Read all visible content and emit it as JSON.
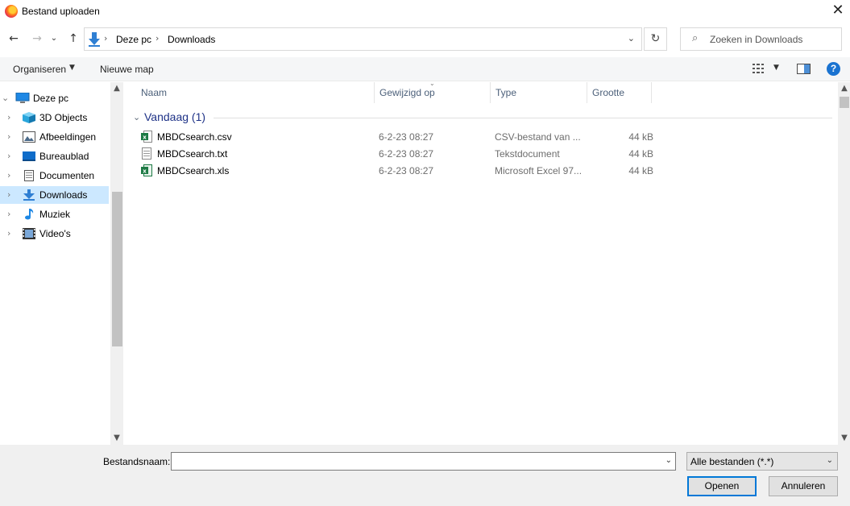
{
  "window": {
    "title": "Bestand uploaden",
    "close_glyph": "✕"
  },
  "nav_buttons": {
    "back_glyph": "←",
    "forward_glyph": "→",
    "recent_glyph": "⌄",
    "up_glyph": "↑"
  },
  "address": {
    "breadcrumbs": [
      "Deze pc",
      "Downloads"
    ],
    "separator": "›",
    "dropdown_glyph": "⌄",
    "refresh_glyph": "↻"
  },
  "search": {
    "placeholder": "Zoeken in Downloads",
    "icon": "search-icon"
  },
  "toolbar": {
    "organize_label": "Organiseren",
    "new_folder_label": "Nieuwe map",
    "help_glyph": "?"
  },
  "nav_pane": {
    "items": [
      {
        "label": "Deze pc",
        "icon": "computer-icon",
        "selected": false
      },
      {
        "label": "3D Objects",
        "icon": "cube-icon",
        "selected": false
      },
      {
        "label": "Afbeeldingen",
        "icon": "pictures-icon",
        "selected": false
      },
      {
        "label": "Bureaublad",
        "icon": "desktop-icon",
        "selected": false
      },
      {
        "label": "Documenten",
        "icon": "documents-icon",
        "selected": false
      },
      {
        "label": "Downloads",
        "icon": "download-icon",
        "selected": true
      },
      {
        "label": "Muziek",
        "icon": "music-icon",
        "selected": false
      },
      {
        "label": "Video's",
        "icon": "video-icon",
        "selected": false
      }
    ]
  },
  "file_list": {
    "columns": [
      "Naam",
      "Gewijzigd op",
      "Type",
      "Grootte"
    ],
    "group": {
      "label": "Vandaag (1)"
    },
    "rows": [
      {
        "name": "MBDCsearch.csv",
        "date": "6-2-23 08:27",
        "type": "CSV-bestand van ...",
        "size": "44 kB",
        "icon": "excel-csv-icon"
      },
      {
        "name": "MBDCsearch.txt",
        "date": "6-2-23 08:27",
        "type": "Tekstdocument",
        "size": "44 kB",
        "icon": "text-file-icon"
      },
      {
        "name": "MBDCsearch.xls",
        "date": "6-2-23 08:27",
        "type": "Microsoft Excel 97...",
        "size": "44 kB",
        "icon": "excel-file-icon"
      }
    ]
  },
  "footer": {
    "filename_label": "Bestandsnaam:",
    "filename_value": "",
    "filter_value": "Alle bestanden (*.*)",
    "open_label": "Openen",
    "cancel_label": "Annuleren"
  },
  "colors": {
    "accent": "#0078d7",
    "selection": "#cce8ff",
    "group_header": "#1e3287"
  }
}
